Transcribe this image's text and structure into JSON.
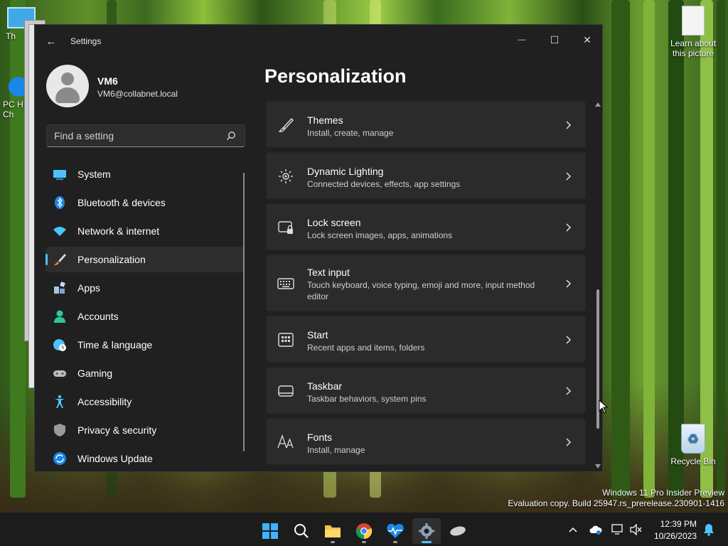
{
  "desktop": {
    "icons": [
      {
        "label": "Th"
      },
      {
        "label": "PC H\nCh"
      },
      {
        "label": "Learn about\nthis picture"
      },
      {
        "label": "Recycle Bin"
      }
    ],
    "watermark": {
      "line1": "Windows 11 Pro Insider Preview",
      "line2": "Evaluation copy. Build 25947.rs_prerelease.230901-1416"
    }
  },
  "window": {
    "title": "Settings",
    "controls": {
      "minimize": "—",
      "maximize": "☐",
      "close": "✕"
    },
    "user": {
      "name": "VM6",
      "email": "VM6@collabnet.local"
    },
    "search": {
      "placeholder": "Find a setting"
    },
    "nav": [
      {
        "label": "System",
        "icon": "system-icon",
        "color": "#4cc2ff"
      },
      {
        "label": "Bluetooth & devices",
        "icon": "bluetooth-icon",
        "color": "#1a86e8"
      },
      {
        "label": "Network & internet",
        "icon": "network-wifi-icon",
        "color": "#4cc2ff"
      },
      {
        "label": "Personalization",
        "icon": "paintbrush-icon",
        "color": "#e87d3e",
        "active": true
      },
      {
        "label": "Apps",
        "icon": "apps-icon",
        "color": "#a9c4e4"
      },
      {
        "label": "Accounts",
        "icon": "accounts-icon",
        "color": "#2fc69e"
      },
      {
        "label": "Time & language",
        "icon": "globe-clock-icon",
        "color": "#4cc2ff"
      },
      {
        "label": "Gaming",
        "icon": "gamepad-icon",
        "color": "#bcbcbc"
      },
      {
        "label": "Accessibility",
        "icon": "accessibility-icon",
        "color": "#4cc2ff"
      },
      {
        "label": "Privacy & security",
        "icon": "shield-icon",
        "color": "#8a8a8a"
      },
      {
        "label": "Windows Update",
        "icon": "update-icon",
        "color": "#1a86e8"
      }
    ],
    "page_title": "Personalization",
    "cards": [
      {
        "title": "Themes",
        "desc": "Install, create, manage",
        "icon": "themes-brush-icon"
      },
      {
        "title": "Dynamic Lighting",
        "desc": "Connected devices, effects, app settings",
        "icon": "dynamic-lighting-icon"
      },
      {
        "title": "Lock screen",
        "desc": "Lock screen images, apps, animations",
        "icon": "lock-screen-icon"
      },
      {
        "title": "Text input",
        "desc": "Touch keyboard, voice typing, emoji and more, input method editor",
        "icon": "keyboard-icon"
      },
      {
        "title": "Start",
        "desc": "Recent apps and items, folders",
        "icon": "start-icon"
      },
      {
        "title": "Taskbar",
        "desc": "Taskbar behaviors, system pins",
        "icon": "taskbar-icon"
      },
      {
        "title": "Fonts",
        "desc": "Install, manage",
        "icon": "fonts-icon"
      }
    ]
  },
  "taskbar": {
    "apps": [
      {
        "name": "start-button"
      },
      {
        "name": "search-button"
      },
      {
        "name": "file-explorer-button"
      },
      {
        "name": "chrome-button"
      },
      {
        "name": "health-monitor-button"
      },
      {
        "name": "settings-button",
        "active": true
      },
      {
        "name": "mouse-app-button"
      }
    ],
    "clock": {
      "time": "12:39 PM",
      "date": "10/26/2023"
    }
  },
  "colors": {
    "accent": "#4cc2ff",
    "window_bg": "#202020",
    "card_bg": "#2b2b2b"
  }
}
